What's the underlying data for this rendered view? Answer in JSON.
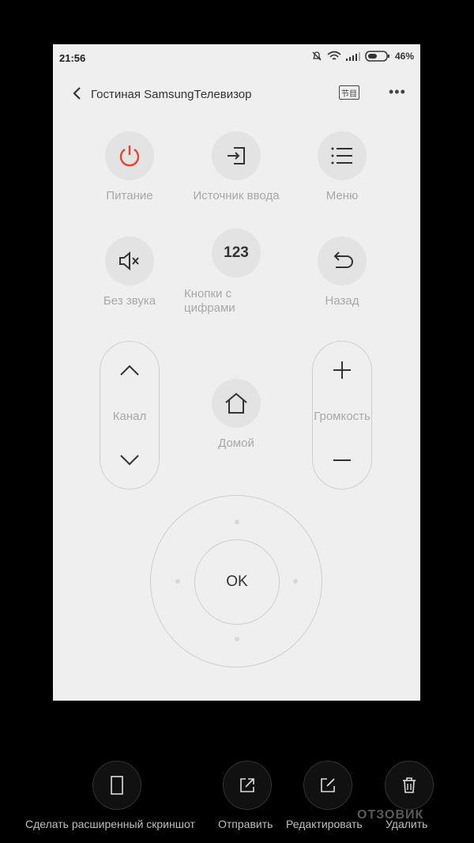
{
  "status": {
    "time": "21:56",
    "battery": "46%"
  },
  "header": {
    "title": "Гостиная SamsungТелевизор",
    "guide_label": "节目",
    "more": "•••"
  },
  "buttons": {
    "power": "Питание",
    "input": "Источник ввода",
    "menu": "Меню",
    "mute": "Без звука",
    "numbers_icon": "123",
    "numbers_line1": "Кнопки с",
    "numbers_line2": "цифрами",
    "back": "Назад",
    "channel": "Канал",
    "home": "Домой",
    "volume": "Громкость",
    "ok": "OK"
  },
  "toolbar": {
    "extended": "Сделать расширенный скриншот",
    "share": "Отправить",
    "edit": "Редактировать",
    "delete": "Удалить"
  },
  "watermark": "ОТЗОВИК",
  "colors": {
    "power": "#e5432b",
    "bg": "#efefef"
  }
}
